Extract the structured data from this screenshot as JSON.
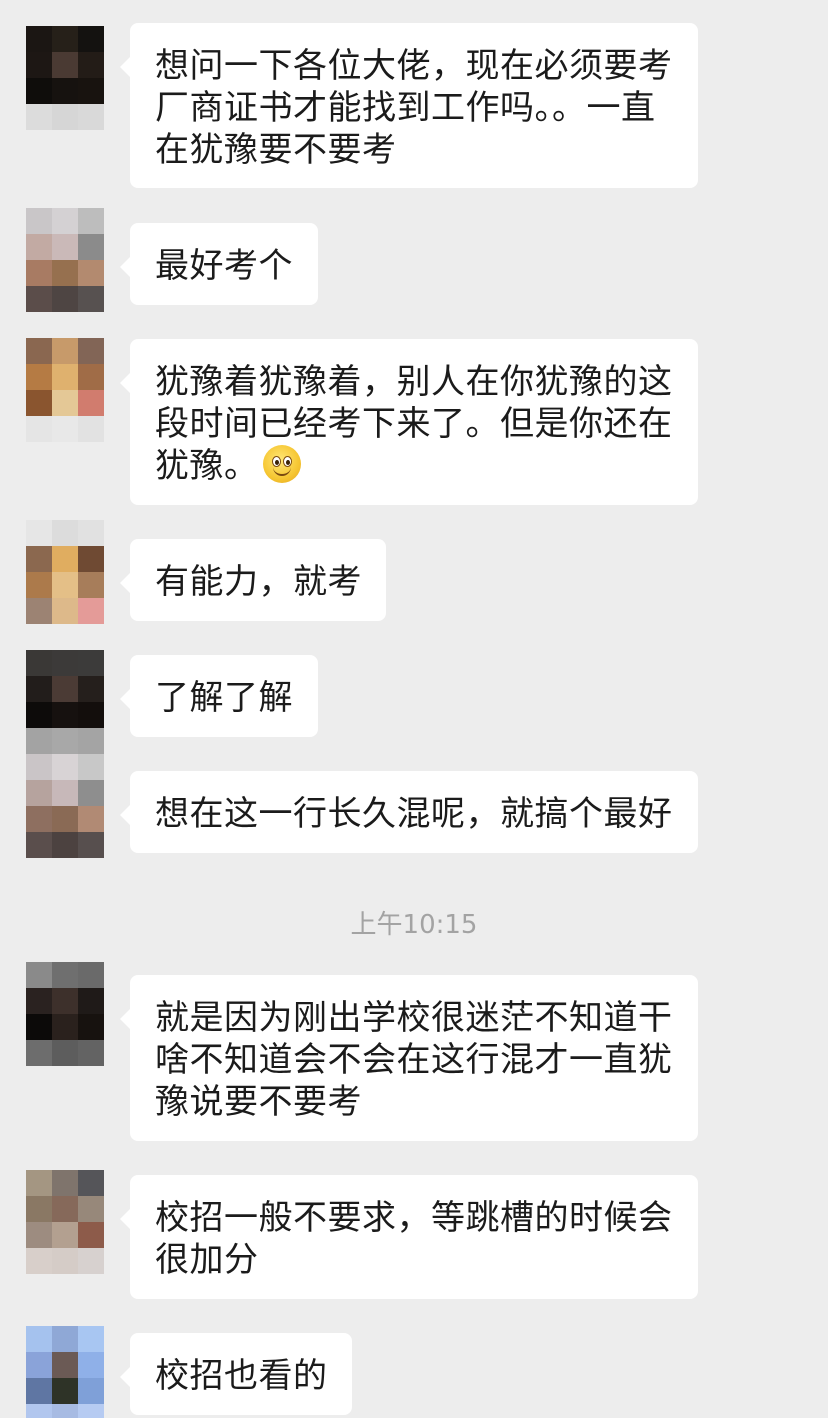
{
  "timestamp": "上午10:15",
  "emoji_icon": "smiling-face-emoji",
  "messages": [
    {
      "lines": [
        "想问一下各位大佬，现在必须要考",
        "厂商证书才能找到工作吗。。一直",
        "在犹豫要不要考"
      ],
      "avatar": [
        "#1b1613",
        "#262019",
        "#141210",
        "#1d1714",
        "#4a3a33",
        "#231c17",
        "#0f0d0b",
        "#16120f",
        "#18130f"
      ],
      "avatar_fade": [
        "#dcdcdc",
        "#d6d6d6",
        "#d9d9d9"
      ]
    },
    {
      "lines": [
        "最好考个"
      ],
      "avatar": [
        "#c9c6c8",
        "#d4d1d3",
        "#bdbdbd",
        "#c2aaa3",
        "#cab9b8",
        "#8b8b8b",
        "#a87b63",
        "#96704f",
        "#b38a6f"
      ],
      "avatar_fade": [
        "#5b4d4a",
        "#4e4543",
        "#575150"
      ]
    },
    {
      "lines": [
        "犹豫着犹豫着，别人在你犹豫的这",
        "段时间已经考下来了。但是你还在",
        "犹豫。"
      ],
      "emoji_on_line": 2,
      "avatar": [
        "#8a6750",
        "#c79a6a",
        "#826556",
        "#b57b44",
        "#dfb16e",
        "#a06c47",
        "#8a552f",
        "#e4c896",
        "#d17c6e"
      ],
      "avatar_fade": [
        "#e5e5e5",
        "#e8e8e8",
        "#e2e2e2"
      ]
    },
    {
      "lines": [
        "有能力，就考"
      ],
      "avatar": [
        "#8b684f",
        "#e0ad60",
        "#6f4a33",
        "#ac7a4b",
        "#e4bf87",
        "#a77d5a",
        "#9c8373",
        "#ddb98a",
        "#e49b98"
      ],
      "avatar_fade": [
        "#e6e6e6",
        "#dcdcdc",
        "#e1e1e1"
      ]
    },
    {
      "lines": [
        "了解了解"
      ],
      "avatar": [
        "#3a3836",
        "#3c3a39",
        "#3c3b3a",
        "#221d1b",
        "#4b3b35",
        "#251f1c",
        "#0d0b0a",
        "#16110f",
        "#130e0c"
      ],
      "avatar_fade": [
        "#a3a3a3",
        "#a8a8a8",
        "#a4a4a4"
      ]
    },
    {
      "lines": [
        "想在这一行长久混呢，就搞个最好"
      ],
      "avatar": [
        "#cac5c7",
        "#d8d3d5",
        "#c8c8c8",
        "#b6a39e",
        "#c7b8b9",
        "#8e8e8e",
        "#8e6f60",
        "#8a6a55",
        "#b18a74"
      ],
      "avatar_fade": [
        "#5a4e4c",
        "#4c4240",
        "#574f4e"
      ]
    },
    {
      "lines": [
        "就是因为刚出学校很迷茫不知道干",
        "啥不知道会不会在这行混才一直犹",
        "豫说要不要考"
      ],
      "avatar": [
        "#8a8a8a",
        "#6f6f6f",
        "#6a6a6a",
        "#2a2220",
        "#3d302b",
        "#1f1a18",
        "#0c0a09",
        "#2a211d",
        "#17120f"
      ],
      "avatar_fade": [
        "#6d6d6d",
        "#5d5d5d",
        "#636363"
      ]
    },
    {
      "lines": [
        "校招一般不要求，等跳槽的时候会",
        "很加分"
      ],
      "avatar": [
        "#a49682",
        "#7f746c",
        "#555559",
        "#8a7864",
        "#86695a",
        "#97887a",
        "#9d8c80",
        "#b3a090",
        "#8d5b4a"
      ],
      "avatar_fade": [
        "#d8cfca",
        "#d5ccc7",
        "#d7d1cf"
      ]
    },
    {
      "lines": [
        "校招也看的"
      ],
      "avatar": [
        "#a5c2ee",
        "#8fa8d6",
        "#a8c6f2",
        "#8aa3d9",
        "#6b5a55",
        "#8fb0e8",
        "#5f76a3",
        "#2e3327",
        "#7fa0d8"
      ],
      "avatar_fade": [
        "#b1c6ee",
        "#a7bbe3",
        "#b6cbf2"
      ]
    }
  ]
}
